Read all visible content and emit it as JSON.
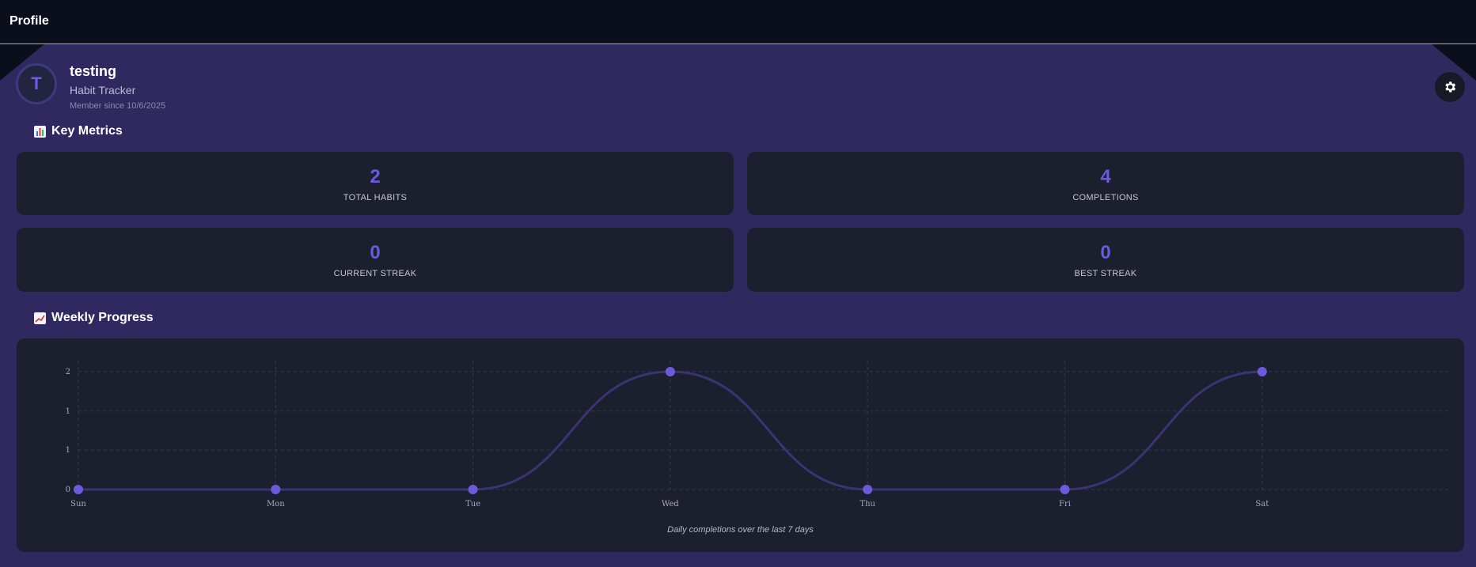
{
  "header": {
    "title": "Profile"
  },
  "profile": {
    "avatar_initial": "T",
    "username": "testing",
    "subtitle": "Habit Tracker",
    "member_since": "Member since 10/6/2025"
  },
  "sections": {
    "metrics_title": "Key Metrics",
    "progress_title": "Weekly Progress"
  },
  "metrics": [
    {
      "value": "2",
      "label": "TOTAL HABITS"
    },
    {
      "value": "4",
      "label": "COMPLETIONS"
    },
    {
      "value": "0",
      "label": "CURRENT STREAK"
    },
    {
      "value": "0",
      "label": "BEST STREAK"
    }
  ],
  "chart_data": {
    "type": "line",
    "categories": [
      "Sun",
      "Mon",
      "Tue",
      "Wed",
      "Thu",
      "Fri",
      "Sat"
    ],
    "series": [
      {
        "values": [
          0,
          0,
          0,
          2,
          0,
          0,
          2
        ]
      }
    ],
    "y_ticks": [
      {
        "value": 0,
        "label": "0"
      },
      {
        "value": 0.67,
        "label": "1"
      },
      {
        "value": 1.33,
        "label": "1"
      },
      {
        "value": 2,
        "label": "2"
      }
    ],
    "ylim": [
      0,
      2
    ],
    "grid": true,
    "smooth": true,
    "caption": "Daily completions over the last 7 days"
  },
  "colors": {
    "accent": "#6b5bdc",
    "line": "#3a3475",
    "background": "#30295f",
    "card": "#1b1f2e",
    "topbar": "#0b0f1b"
  },
  "icons": {
    "settings": "gear-icon",
    "metrics": "bar-chart-icon",
    "progress": "trending-up-icon"
  }
}
